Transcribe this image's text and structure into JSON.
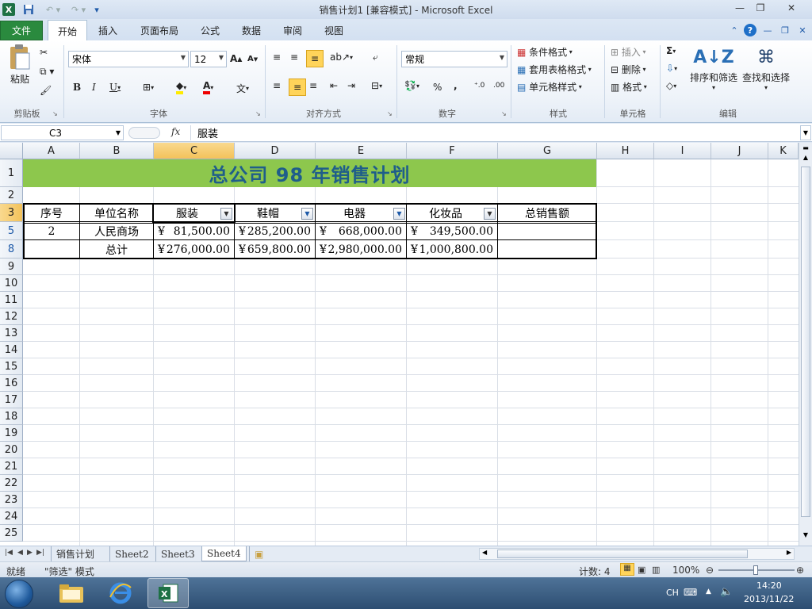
{
  "window": {
    "title": "销售计划1  [兼容模式]  -  Microsoft Excel"
  },
  "tabs": {
    "file": "文件",
    "items": [
      "开始",
      "插入",
      "页面布局",
      "公式",
      "数据",
      "审阅",
      "视图"
    ]
  },
  "ribbon": {
    "clipboard": {
      "label": "剪贴板",
      "paste": "粘贴"
    },
    "font": {
      "label": "字体",
      "name": "宋体",
      "size": "12"
    },
    "alignment": {
      "label": "对齐方式"
    },
    "number": {
      "label": "数字",
      "format": "常规",
      "percent": "%",
      "comma": ","
    },
    "styles": {
      "label": "样式",
      "conditional": "条件格式",
      "table": "套用表格格式",
      "cell_styles": "单元格样式"
    },
    "cells": {
      "label": "单元格",
      "insert": "插入",
      "delete": "删除",
      "format": "格式"
    },
    "editing": {
      "label": "编辑",
      "sort": "排序和筛选",
      "find": "查找和选择"
    }
  },
  "formula_bar": {
    "name_box": "C3",
    "fx": "fx",
    "content": "服装"
  },
  "columns": [
    "A",
    "B",
    "C",
    "D",
    "E",
    "F",
    "G",
    "H",
    "I",
    "J",
    "K"
  ],
  "rows": [
    "1",
    "2",
    "3",
    "5",
    "8",
    "9",
    "10",
    "11",
    "12",
    "13",
    "14",
    "15",
    "16",
    "17",
    "18",
    "19",
    "20",
    "21",
    "22",
    "23",
    "24",
    "25"
  ],
  "sheet": {
    "title": "总公司  98  年销售计划",
    "headers": [
      "序号",
      "单位名称",
      "服装",
      "鞋帽",
      "电器",
      "化妆品",
      "总销售额"
    ],
    "row5": {
      "a": "2",
      "b": "人民商场",
      "c": "81,500.00",
      "d": "285,200.00",
      "e": "668,000.00",
      "f": "349,500.00"
    },
    "row8": {
      "b": "总计",
      "c": "276,000.00",
      "d": "659,800.00",
      "e": "2,980,000.00",
      "f": "1,000,800.00"
    },
    "currency": "¥"
  },
  "sheet_tabs": [
    "销售计划",
    "Sheet2",
    "Sheet3",
    "Sheet4"
  ],
  "status": {
    "ready": "就绪",
    "mode": "\"筛选\" 模式",
    "count": "计数: 4",
    "zoom": "100%"
  },
  "tray": {
    "lang": "CH",
    "time": "14:20",
    "date": "2013/11/22"
  }
}
